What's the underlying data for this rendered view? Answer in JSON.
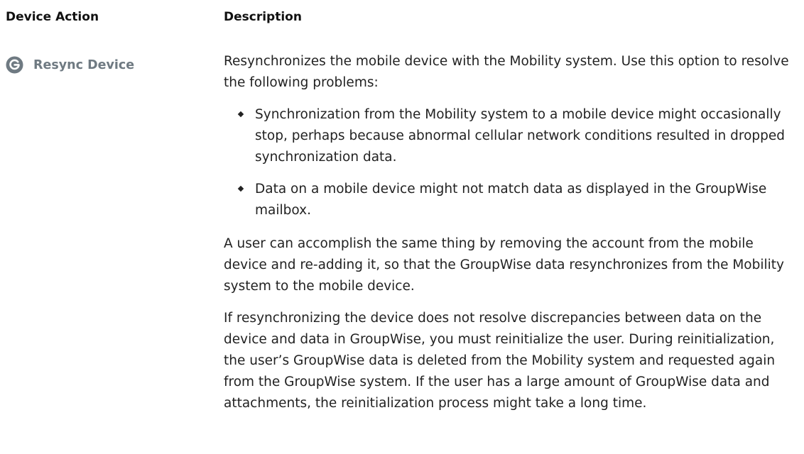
{
  "table": {
    "headers": {
      "action": "Device Action",
      "description": "Description"
    },
    "row": {
      "action_icon": "resync-icon",
      "action_label": "Resync Device",
      "intro": "Resynchronizes the mobile device with the Mobility system. Use this option to resolve the following problems:",
      "bullets": [
        "Synchronization from the Mobility system to a mobile device might occasionally stop, perhaps because abnormal cellular network conditions resulted in dropped synchronization data.",
        "Data on a mobile device might not match data as displayed in the GroupWise mailbox."
      ],
      "paragraph_2": "A user can accomplish the same thing by removing the account from the mobile device and re-adding it, so that the GroupWise data resynchronizes from the Mobility system to the mobile device.",
      "paragraph_3": "If resynchronizing the device does not resolve discrepancies between data on the device and data in GroupWise, you must reinitialize the user. During reinitialization, the user’s GroupWise data is deleted from the Mobility system and requested again from the GroupWise system. If the user has a large amount of GroupWise data and attachments, the reinitialization process might take a long time."
    }
  },
  "colors": {
    "icon_fill": "#6f7a82",
    "action_label": "#6f7a82",
    "text": "#222222"
  }
}
